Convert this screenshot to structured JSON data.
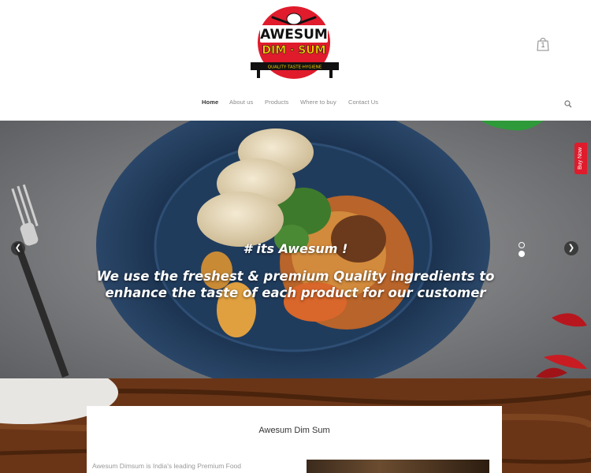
{
  "brand": {
    "name_line1": "AWESUM",
    "name_line2": "DIM · SUM",
    "tagline": "QUALITY·TASTE·HYGIENE",
    "colors": {
      "red": "#e01b2c",
      "yellow": "#f5d000",
      "black": "#111111"
    }
  },
  "cart": {
    "icon": "bag-icon",
    "count": "1"
  },
  "nav": {
    "items": [
      {
        "label": "Home",
        "active": true
      },
      {
        "label": "About us"
      },
      {
        "label": "Products"
      },
      {
        "label": "Where to buy"
      },
      {
        "label": "Contact Us"
      }
    ],
    "search_icon": "search-icon"
  },
  "hero": {
    "tag": "# its Awesum !",
    "caption_line1": "We use the freshest & premium Quality ingredients to",
    "caption_line2": "enhance the taste of each product for our customer",
    "buy_now": "Buy Now",
    "prev_icon": "chevron-left-icon",
    "next_icon": "chevron-right-icon",
    "slides_total": 2,
    "slide_active": 2
  },
  "intro": {
    "title": "Awesum Dim Sum",
    "text": "Awesum Dimsum is India's leading Premium Food"
  }
}
